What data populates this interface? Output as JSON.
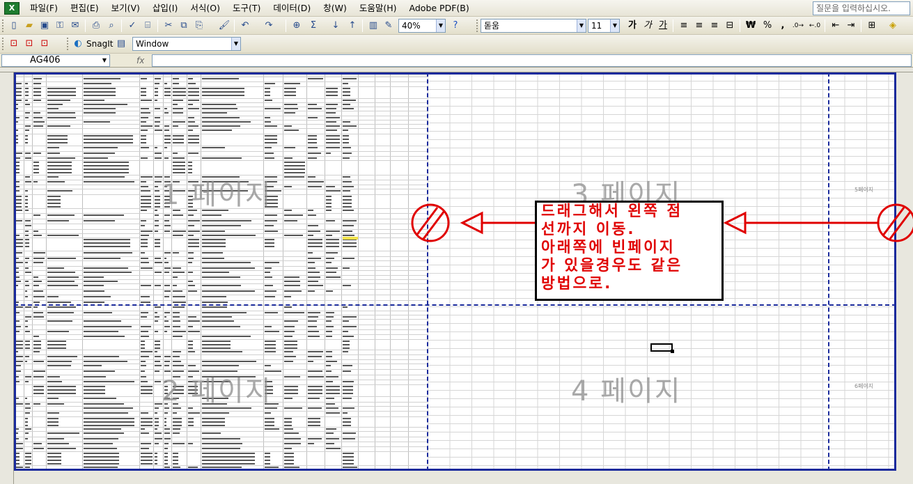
{
  "menu": {
    "items": [
      "파일(F)",
      "편집(E)",
      "보기(V)",
      "삽입(I)",
      "서식(O)",
      "도구(T)",
      "데이터(D)",
      "창(W)",
      "도움말(H)",
      "Adobe PDF(B)"
    ],
    "help_placeholder": "질문을 입력하십시오."
  },
  "toolbar": {
    "zoom": "40%",
    "font_name": "돋움",
    "font_size": "11",
    "bold": "가",
    "italic": "가",
    "underline": "가",
    "currency": "₩",
    "percent": "%",
    "comma": ",",
    "snagit_label": "SnagIt",
    "window_combo": "Window"
  },
  "formula_bar": {
    "name_box": "AG406",
    "fx_label": "fx",
    "formula": ""
  },
  "sheet": {
    "page_labels": [
      "1 페이지",
      "2 페이지",
      "3 페이지",
      "4 페이지"
    ],
    "small_page_labels": [
      "5페이지",
      "6페이지"
    ],
    "callout_lines": [
      "드래그해서 왼쪽 점",
      "선까지 이동.",
      "아래쪽에 빈페이지",
      "가 있을경우도 같은",
      "방법으로."
    ],
    "annotation_color": "#E00000",
    "page_break_color": "#1A2A9C",
    "selected_cell": "AG406"
  }
}
